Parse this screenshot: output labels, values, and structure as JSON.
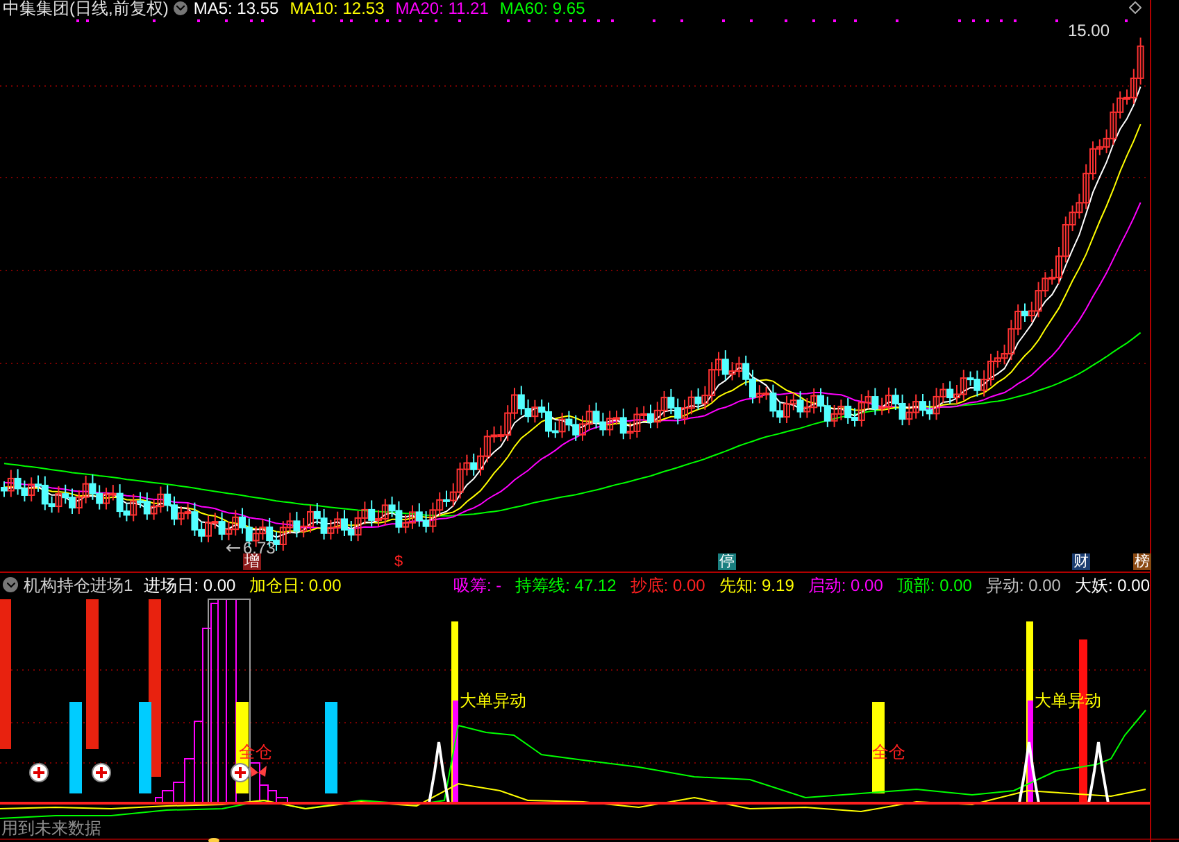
{
  "main_chart": {
    "title": "中集集团(日线,前复权)",
    "ma_legend": [
      {
        "label": "MA5: 13.55",
        "color": "#ffffff"
      },
      {
        "label": "MA10: 12.53",
        "color": "#ffff00"
      },
      {
        "label": "MA20: 11.21",
        "color": "#ff00ff"
      },
      {
        "label": "MA60: 9.65",
        "color": "#00ff00"
      }
    ],
    "high_label": "15.00",
    "low_label": "6.73",
    "event_markers": [
      {
        "text": "增",
        "color": "#8b1a1a"
      },
      {
        "text": "$",
        "color": "#000000"
      },
      {
        "text": "停",
        "color": "#1a7f80"
      },
      {
        "text": "财",
        "color": "#1a3c70"
      },
      {
        "text": "榜",
        "color": "#8b4a13"
      }
    ]
  },
  "indicator": {
    "title": "机构持仓进场1",
    "readouts": [
      {
        "label": "进场日: 0.00",
        "color": "#ffffff"
      },
      {
        "label": "加仓日: 0.00",
        "color": "#ffff00"
      },
      {
        "label": "吸筹: -",
        "color": "#ff00ff"
      },
      {
        "label": "持筹线: 47.12",
        "color": "#00ff00"
      },
      {
        "label": "抄底: 0.00",
        "color": "#ff2020"
      },
      {
        "label": "先知: 9.19",
        "color": "#ffff00"
      },
      {
        "label": "启动: 0.00",
        "color": "#ff00ff"
      },
      {
        "label": "顶部: 0.00",
        "color": "#00ff00"
      },
      {
        "label": "异动: 0.00",
        "color": "#c0c0c0"
      },
      {
        "label": "大妖: 0.00",
        "color": "#ffffff"
      }
    ],
    "annotations": [
      {
        "text": "全仓",
        "kind": "full"
      },
      {
        "text": "大单异动",
        "kind": "big"
      },
      {
        "text": "全仓",
        "kind": "full"
      },
      {
        "text": "大单异动",
        "kind": "big"
      }
    ]
  },
  "footer_note": "用到未来数据"
}
